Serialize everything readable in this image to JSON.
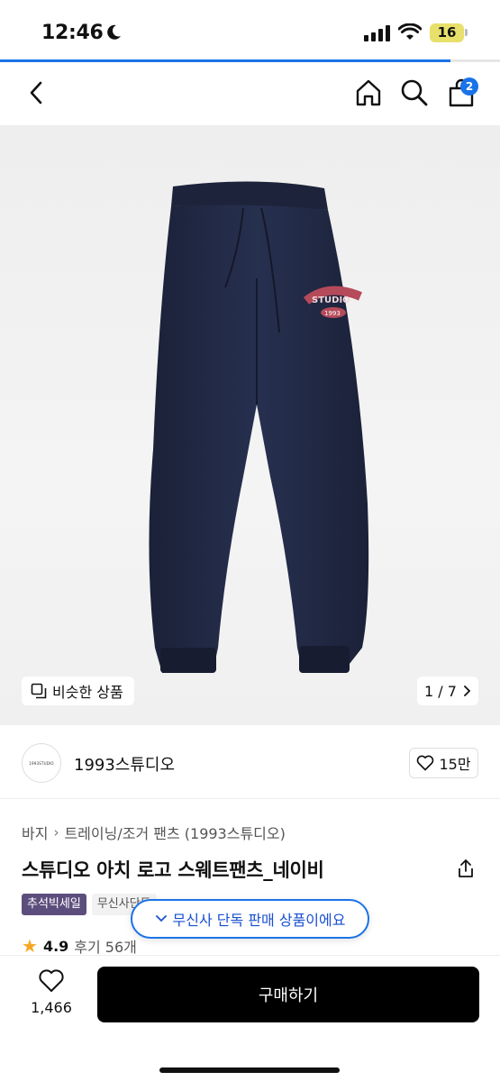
{
  "status": {
    "time": "12:46",
    "battery": "16",
    "icons": [
      "moon-icon",
      "signal-icon",
      "wifi-icon",
      "battery-icon"
    ]
  },
  "progress": {
    "value": 0.9
  },
  "nav": {
    "icons": [
      "back-icon",
      "home-icon",
      "search-icon",
      "cart-icon"
    ],
    "cart_count": "2"
  },
  "gallery": {
    "similar_label": "비슷한 상품",
    "page": "1 / 7"
  },
  "brand": {
    "logo_text": "1993STUDIO",
    "name": "1993스튜디오",
    "likes": "15만"
  },
  "breadcrumb": {
    "items": [
      "바지",
      "트레이닝/조거 팬츠 (1993스튜디오)"
    ]
  },
  "product": {
    "title": "스튜디오 아치 로고 스웨트팬츠_네이비"
  },
  "tags": [
    "추석빅세일",
    "무신사단독"
  ],
  "rating": {
    "score": "4.9",
    "reviews": "후기 56개"
  },
  "toast": {
    "text": "무신사 단독 판매 상품이에요"
  },
  "bottom": {
    "wish_count": "1,466",
    "buy_label": "구매하기"
  },
  "colors": {
    "accent": "#1a73e8",
    "sale_tag": "#5c4e7c",
    "buy_button": "#000000",
    "pants": "#1f2540"
  }
}
